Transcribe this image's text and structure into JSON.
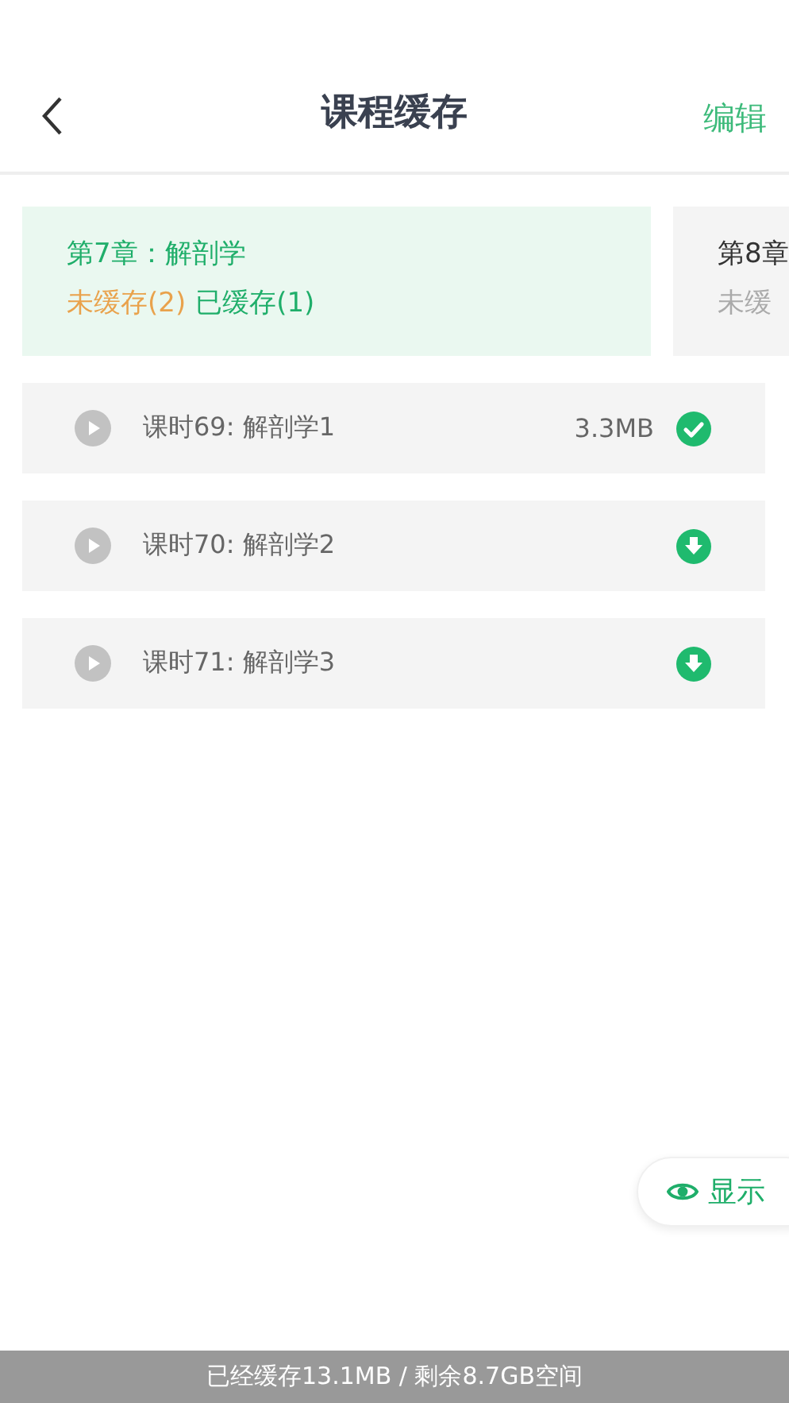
{
  "header": {
    "title": "课程缓存",
    "action": "编辑"
  },
  "chapters": [
    {
      "title": "第7章：解剖学",
      "selected": true,
      "uncached": "未缓存(2)",
      "cached": "已缓存(1)"
    },
    {
      "title": "第8章",
      "selected": false,
      "uncached": "未缓"
    }
  ],
  "lessons": [
    {
      "title": "课时69: 解剖学1",
      "size": "3.3MB",
      "kind": "cached"
    },
    {
      "title": "课时70: 解剖学2",
      "kind": "download"
    },
    {
      "title": "课时71: 解剖学3",
      "kind": "download"
    }
  ],
  "float_button": {
    "label": "显示"
  },
  "footer": "已经缓存13.1MB / 剩余8.7GB空间"
}
